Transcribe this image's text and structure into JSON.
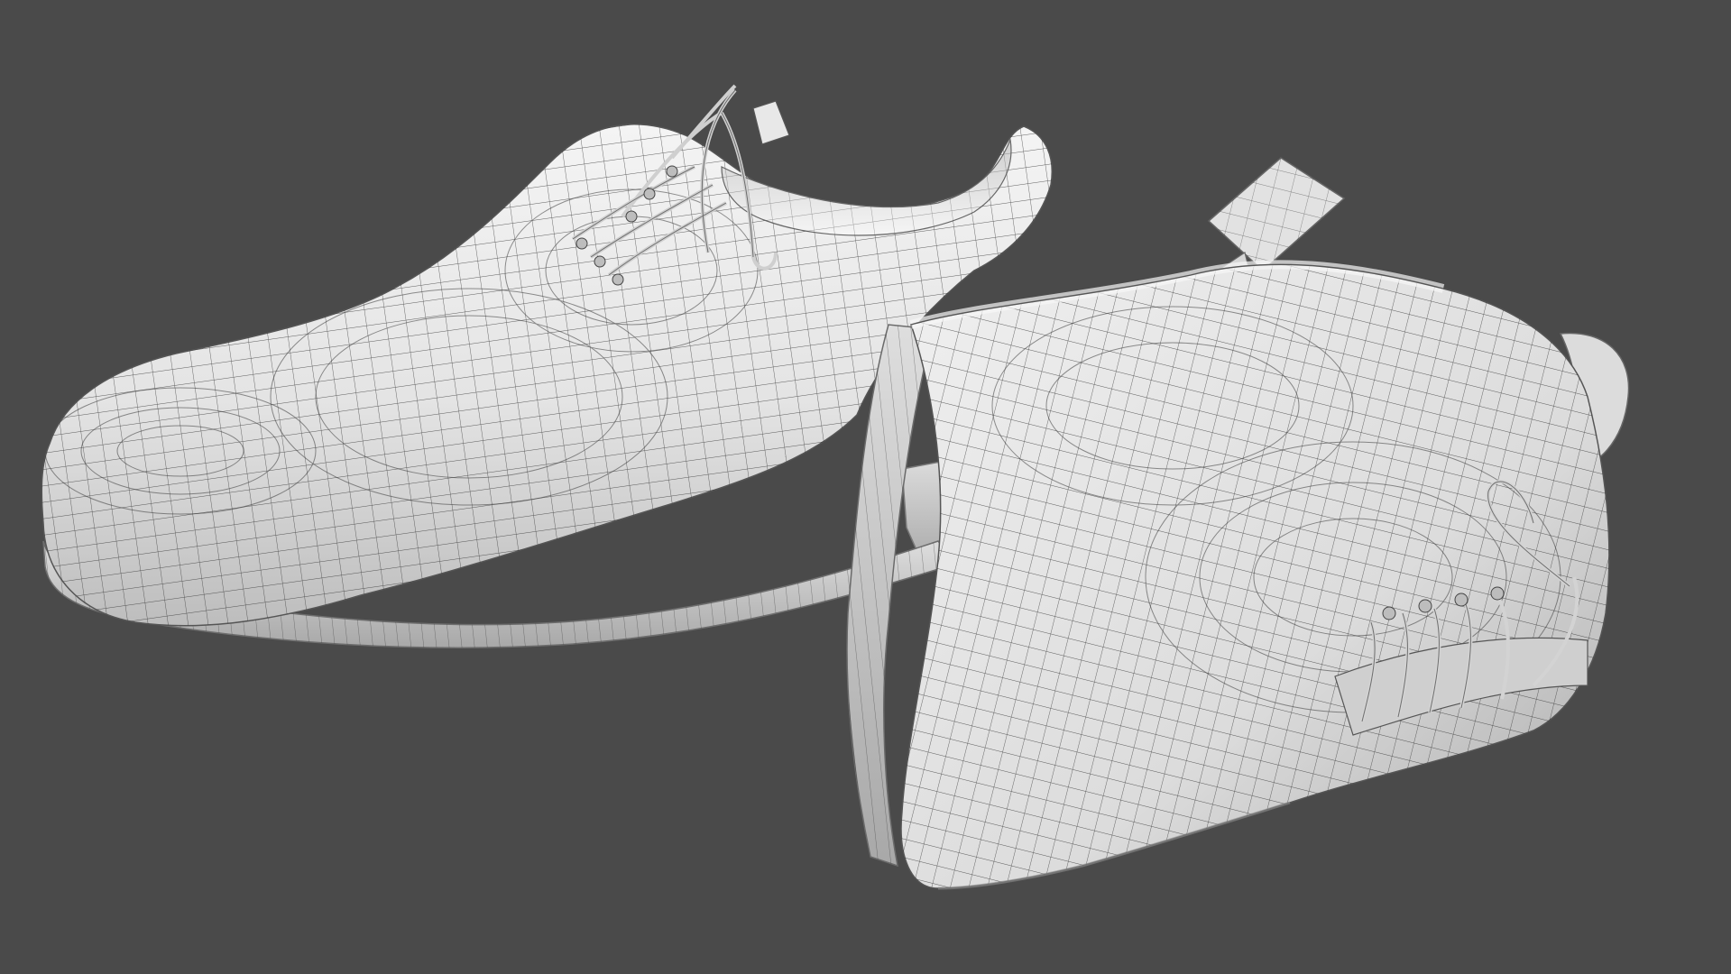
{
  "viewport": {
    "background_color": "#4a4a4a",
    "content": "3d-render-wireframe-overlay"
  },
  "objects": [
    {
      "kind": "shoe",
      "view": "side",
      "material_color": "#e6e6e6",
      "wire_color": "#2a2a2a"
    },
    {
      "kind": "shoe",
      "view": "tilted-front",
      "material_color": "#e6e6e6",
      "wire_color": "#2a2a2a"
    }
  ]
}
